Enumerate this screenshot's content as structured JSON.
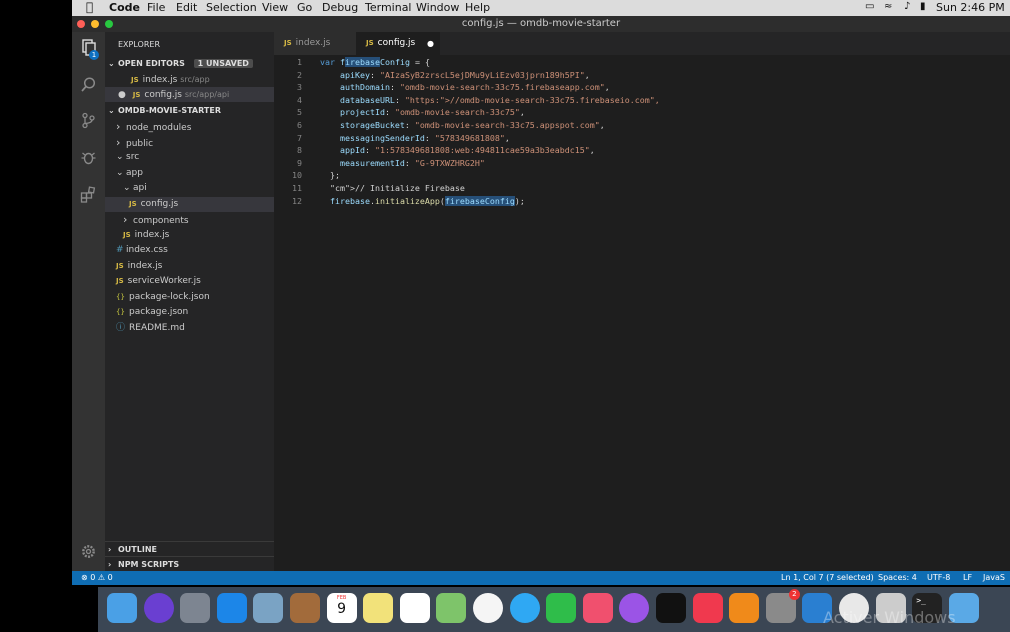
{
  "menubar": {
    "apple": "",
    "app": "Code",
    "items": [
      "File",
      "Edit",
      "Selection",
      "View",
      "Go",
      "Debug",
      "Terminal",
      "Window",
      "Help"
    ],
    "clock": "Sun 2:46 PM"
  },
  "window": {
    "title": "config.js — omdb-movie-starter"
  },
  "activity": {
    "explorer_badge": "1"
  },
  "sidebar": {
    "title": "EXPLORER",
    "open_editors": "OPEN EDITORS",
    "unsaved": "1 UNSAVED",
    "open_files": [
      {
        "name": "index.js",
        "path": "src/app"
      },
      {
        "name": "config.js",
        "path": "src/app/api"
      }
    ],
    "project": "OMDB-MOVIE-STARTER",
    "tree": [
      {
        "name": "node_modules",
        "type": "folder-closed",
        "depth": 1
      },
      {
        "name": "public",
        "type": "folder-closed",
        "depth": 1
      },
      {
        "name": "src",
        "type": "folder-open",
        "depth": 1
      },
      {
        "name": "app",
        "type": "folder-open",
        "depth": 2
      },
      {
        "name": "api",
        "type": "folder-open",
        "depth": 3
      },
      {
        "name": "config.js",
        "type": "js",
        "depth": 4
      },
      {
        "name": "components",
        "type": "folder-closed",
        "depth": 3
      },
      {
        "name": "index.js",
        "type": "js",
        "depth": 3
      },
      {
        "name": "index.css",
        "type": "css",
        "depth": 2
      },
      {
        "name": "index.js",
        "type": "js",
        "depth": 2
      },
      {
        "name": "serviceWorker.js",
        "type": "js",
        "depth": 2
      },
      {
        "name": "package-lock.json",
        "type": "json",
        "depth": 1
      },
      {
        "name": "package.json",
        "type": "json",
        "depth": 1
      },
      {
        "name": "README.md",
        "type": "md",
        "depth": 1
      }
    ],
    "outline": "OUTLINE",
    "npm_scripts": "NPM SCRIPTS"
  },
  "tabs": [
    {
      "label": "index.js",
      "active": false
    },
    {
      "label": "config.js",
      "active": true,
      "modified": true
    }
  ],
  "editor": {
    "line_numbers": [
      "1",
      "2",
      "3",
      "4",
      "5",
      "6",
      "7",
      "8",
      "9",
      "10",
      "11",
      "12"
    ],
    "lines": [
      "var firebaseConfig = {",
      "    apiKey: \"AIzaSyB2zrscL5ejDMu9yLiEzv03jprn189h5PI\",",
      "    authDomain: \"omdb-movie-search-33c75.firebaseapp.com\",",
      "    databaseURL: \"https://omdb-movie-search-33c75.firebaseio.com\",",
      "    projectId: \"omdb-movie-search-33c75\",",
      "    storageBucket: \"omdb-movie-search-33c75.appspot.com\",",
      "    messagingSenderId: \"578349681808\",",
      "    appId: \"1:578349681808:web:494811cae59a3b3eabdc15\",",
      "    measurementId: \"G-9TXWZHRG2H\"",
      "  };",
      "  // Initialize Firebase",
      "  firebase.initializeApp(firebaseConfig);"
    ]
  },
  "status": {
    "problems": "⊗ 0 ⚠ 0",
    "position": "Ln 1, Col 7 (7 selected)",
    "spaces": "Spaces: 4",
    "encoding": "UTF-8",
    "eol": "LF",
    "language": "JavaS"
  },
  "dock": {
    "calendar_month": "FEB",
    "calendar_day": "9",
    "badge": "2",
    "icons": [
      "finder",
      "siri",
      "launchpad",
      "safari",
      "mail",
      "contacts",
      "calendar",
      "notes",
      "reminders",
      "maps",
      "photos",
      "messages",
      "facetime",
      "music",
      "podcasts",
      "apple-tv",
      "news",
      "books",
      "system-preferences",
      "vscode",
      "chrome",
      "disk-utility",
      "terminal",
      "folder"
    ]
  },
  "watermark": "Activer Windows"
}
